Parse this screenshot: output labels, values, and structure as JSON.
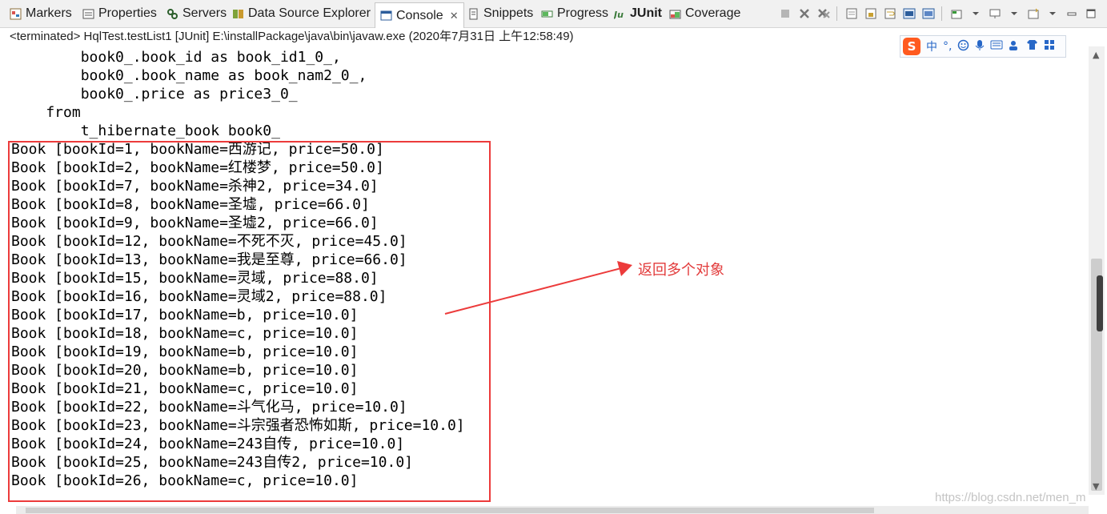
{
  "tabs": [
    {
      "label": "Markers",
      "icon": "markers-icon"
    },
    {
      "label": "Properties",
      "icon": "properties-icon"
    },
    {
      "label": "Servers",
      "icon": "servers-icon"
    },
    {
      "label": "Data Source Explorer",
      "icon": "data-source-icon"
    },
    {
      "label": "Console",
      "icon": "console-icon",
      "close": "✕"
    },
    {
      "label": "Snippets",
      "icon": "snippets-icon"
    },
    {
      "label": "Progress",
      "icon": "progress-icon"
    },
    {
      "label": "JUnit",
      "icon": "junit-icon"
    },
    {
      "label": "Coverage",
      "icon": "coverage-icon"
    }
  ],
  "status": "<terminated> HqlTest.testList1 [JUnit] E:\\installPackage\\java\\bin\\javaw.exe (2020年7月31日 上午12:58:49)",
  "console_lines": [
    "        book0_.book_id as book_id1_0_,",
    "        book0_.book_name as book_nam2_0_,",
    "        book0_.price as price3_0_",
    "    from",
    "        t_hibernate_book book0_",
    "Book [bookId=1, bookName=西游记, price=50.0]",
    "Book [bookId=2, bookName=红楼梦, price=50.0]",
    "Book [bookId=7, bookName=杀神2, price=34.0]",
    "Book [bookId=8, bookName=圣墟, price=66.0]",
    "Book [bookId=9, bookName=圣墟2, price=66.0]",
    "Book [bookId=12, bookName=不死不灭, price=45.0]",
    "Book [bookId=13, bookName=我是至尊, price=66.0]",
    "Book [bookId=15, bookName=灵域, price=88.0]",
    "Book [bookId=16, bookName=灵域2, price=88.0]",
    "Book [bookId=17, bookName=b, price=10.0]",
    "Book [bookId=18, bookName=c, price=10.0]",
    "Book [bookId=19, bookName=b, price=10.0]",
    "Book [bookId=20, bookName=b, price=10.0]",
    "Book [bookId=21, bookName=c, price=10.0]",
    "Book [bookId=22, bookName=斗气化马, price=10.0]",
    "Book [bookId=23, bookName=斗宗强者恐怖如斯, price=10.0]",
    "Book [bookId=24, bookName=243自传, price=10.0]",
    "Book [bookId=25, bookName=243自传2, price=10.0]",
    "Book [bookId=26, bookName=c, price=10.0]"
  ],
  "annotation": "返回多个对象",
  "ime": {
    "logo": "S",
    "mode": "中",
    "punct": "°,"
  },
  "watermark": "https://blog.csdn.net/men_m",
  "colors": {
    "annotation_red": "#ec3b3b",
    "tab_bg": "#f1f1f1",
    "ime_blue": "#2767c7"
  }
}
